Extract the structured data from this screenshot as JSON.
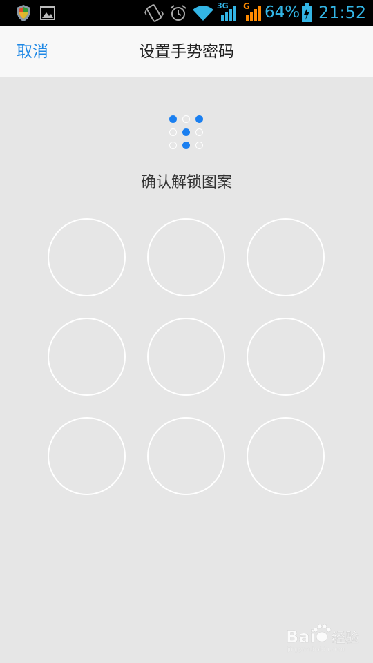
{
  "status_bar": {
    "battery_percent": "64%",
    "time": "21:52",
    "network_3g_label": "3G",
    "network_g_label": "G",
    "icons": [
      "shield-icon",
      "image-icon",
      "vibrate-icon",
      "alarm-icon",
      "wifi-icon",
      "signal-3g-icon",
      "signal-g-icon",
      "battery-charging-icon"
    ],
    "accent_color": "#33b5e5"
  },
  "header": {
    "cancel_label": "取消",
    "title": "设置手势密码"
  },
  "preview": {
    "pattern_nodes_on": [
      1,
      3,
      5,
      8
    ],
    "active_color": "#1a7ff0"
  },
  "prompt": {
    "text": "确认解锁图案"
  },
  "pattern_grid": {
    "nodes": [
      1,
      2,
      3,
      4,
      5,
      6,
      7,
      8,
      9
    ]
  },
  "watermark": {
    "text_latin": "Bai",
    "text_cn": "经验",
    "subtext": "jingyan.baidu.com"
  }
}
